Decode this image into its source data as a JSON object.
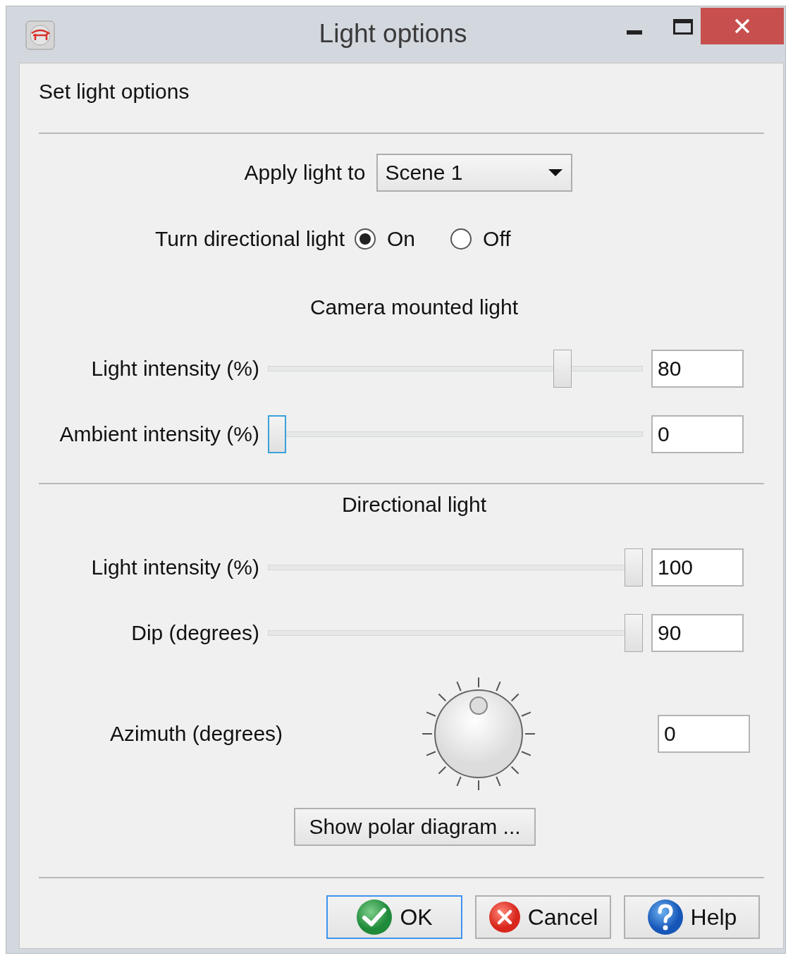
{
  "window": {
    "title": "Light options"
  },
  "heading": "Set light options",
  "apply_light": {
    "label": "Apply light to",
    "value": "Scene 1"
  },
  "directional_toggle": {
    "label": "Turn directional light",
    "options": [
      {
        "label": "On",
        "selected": true
      },
      {
        "label": "Off",
        "selected": false
      }
    ]
  },
  "sections": [
    {
      "title": "Camera mounted light",
      "sliders": [
        {
          "label": "Light intensity (%)",
          "level": 0.8,
          "value": "80",
          "focused": false
        },
        {
          "label": "Ambient intensity (%)",
          "level": 0,
          "value": "0",
          "focused": true
        }
      ]
    },
    {
      "title": "Directional light",
      "sliders": [
        {
          "label": "Light intensity (%)",
          "level": 1,
          "value": "100",
          "focused": false
        },
        {
          "label": "Dip (degrees)",
          "level": 1,
          "value": "90",
          "focused": false
        }
      ],
      "dial": {
        "label": "Azimuth (degrees)",
        "value": "0"
      },
      "button": "Show polar diagram ..."
    }
  ],
  "buttons": [
    {
      "label": "OK",
      "kind": "ok",
      "focused": true
    },
    {
      "label": "Cancel",
      "kind": "cancel",
      "focused": false
    },
    {
      "label": "Help",
      "kind": "help",
      "focused": false
    }
  ]
}
